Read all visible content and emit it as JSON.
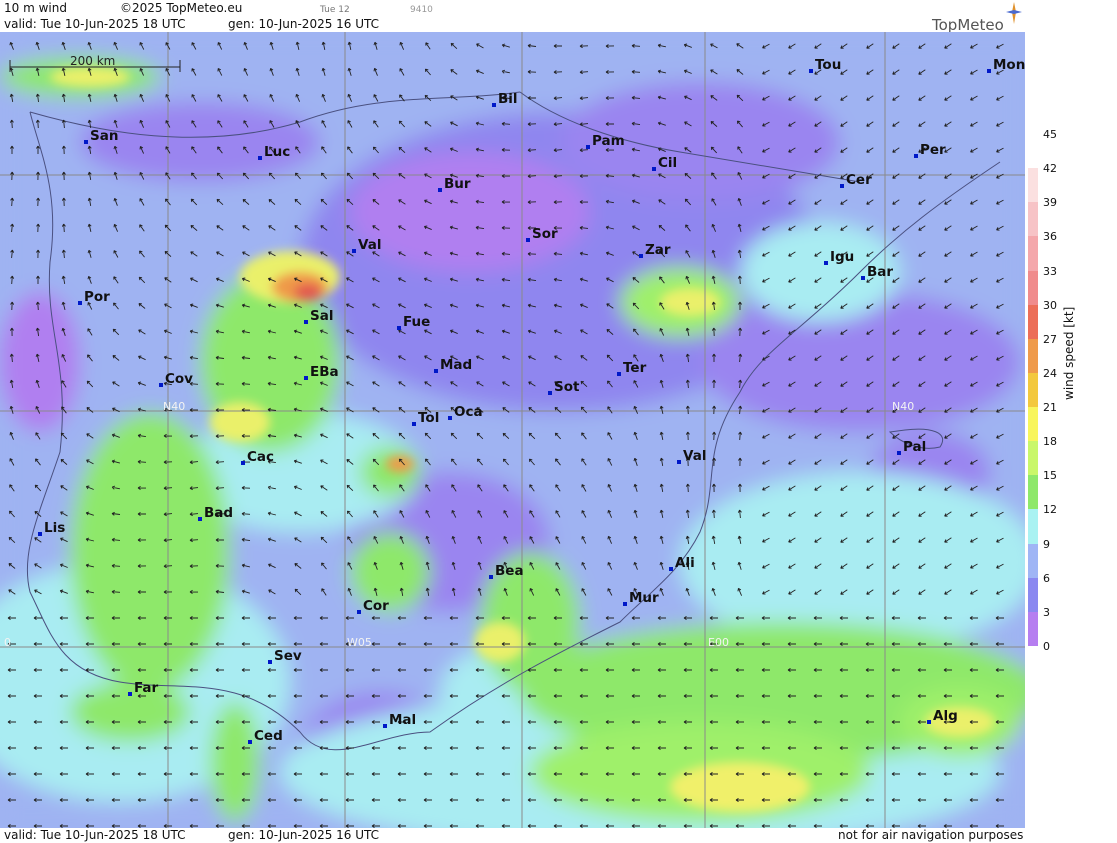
{
  "header": {
    "title": "10 m wind",
    "copyright": "©2025 TopMeteo.eu",
    "small_date": "Tue 12",
    "small_code": "9410",
    "valid": "valid:  Tue  10-Jun-2025  18 UTC",
    "gen": "gen: 10-Jun-2025 16 UTC",
    "logo": "TopMeteo"
  },
  "footer": {
    "valid": "valid:  Tue  10-Jun-2025  18 UTC",
    "gen": "gen: 10-Jun-2025 16 UTC",
    "disclaimer": "not for air navigation purposes"
  },
  "map": {
    "scale_label": "200 km",
    "gridlines": [
      "N40",
      "W05",
      "E00",
      "0"
    ],
    "cities": [
      "San",
      "Luc",
      "Bil",
      "Pam",
      "Cil",
      "Tou",
      "Mon",
      "Per",
      "Bur",
      "Cer",
      "Val",
      "Sor",
      "Zar",
      "Igu",
      "Bar",
      "Por",
      "Sal",
      "Fue",
      "Mad",
      "Cov",
      "EBa",
      "Sot",
      "Ter",
      "Tol",
      "Oca",
      "Pal",
      "Cac",
      "Val",
      "Bad",
      "Lis",
      "Ali",
      "Bea",
      "Mur",
      "Cor",
      "Sev",
      "Far",
      "Mal",
      "Ced",
      "Alg"
    ]
  },
  "legend": {
    "title": "wind speed [kt]",
    "ticks": [
      "45",
      "42",
      "39",
      "36",
      "33",
      "30",
      "27",
      "24",
      "21",
      "18",
      "15",
      "12",
      "9",
      "6",
      "3",
      "0"
    ],
    "colors": [
      "#ffffff",
      "#fbe0e0",
      "#f7c3c6",
      "#f4a7ab",
      "#f08b8c",
      "#ec6e58",
      "#ef9a4a",
      "#f3c83d",
      "#f8f55c",
      "#c9f76a",
      "#8ee86b",
      "#a9f2f2",
      "#9fb5f5",
      "#8a88f0",
      "#b67ef0",
      "#ffffff"
    ]
  }
}
